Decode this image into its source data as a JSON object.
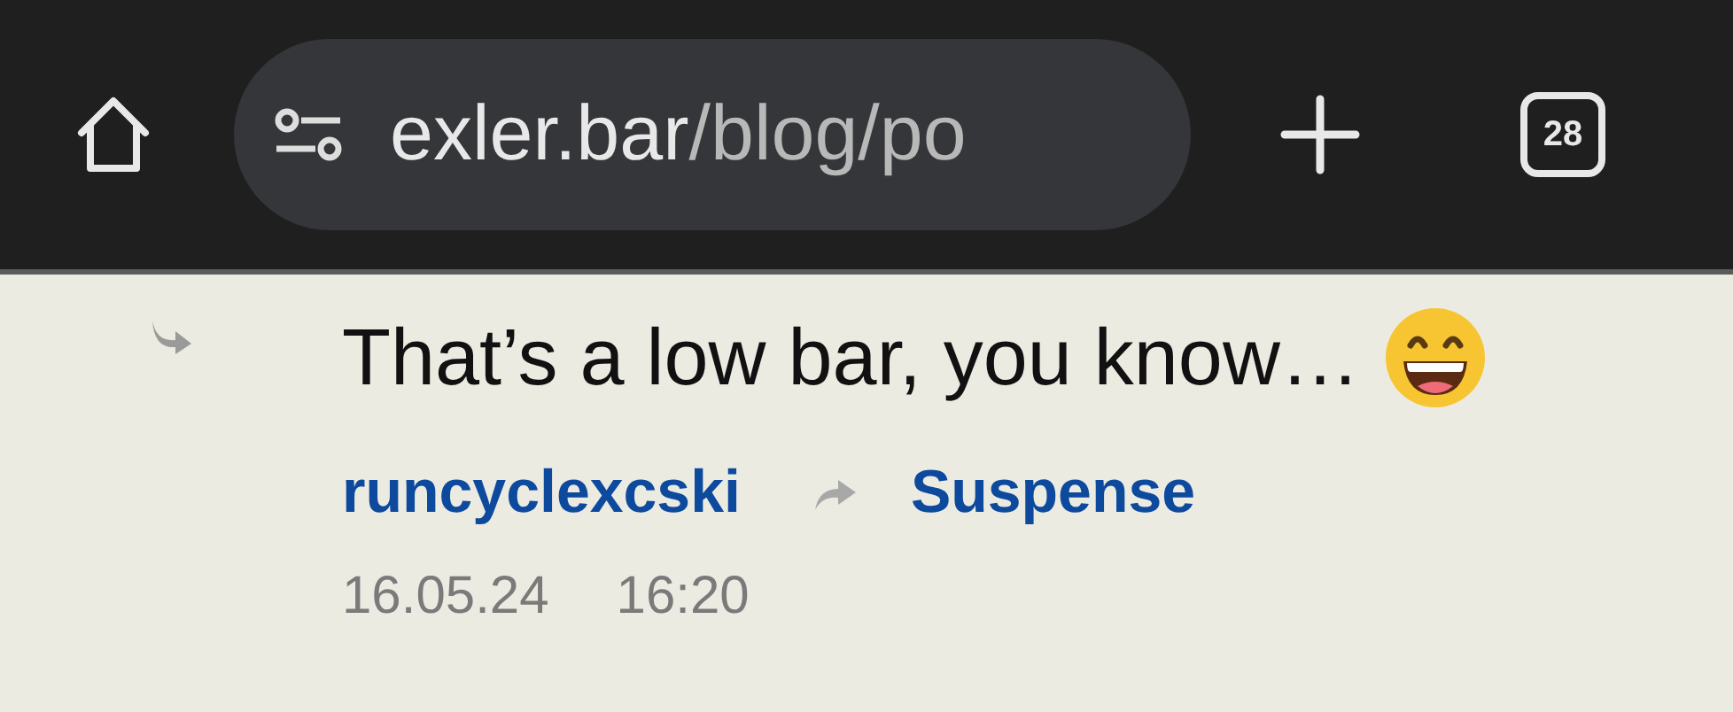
{
  "toolbar": {
    "address": {
      "host": "exler.bar",
      "path": "/blog/po"
    },
    "tab_count": "28"
  },
  "comment": {
    "text": "That’s a low bar, you know…",
    "author": "runcyclexcski",
    "reply_to": "Suspense",
    "date": "16.05.24",
    "time": "16:20"
  }
}
